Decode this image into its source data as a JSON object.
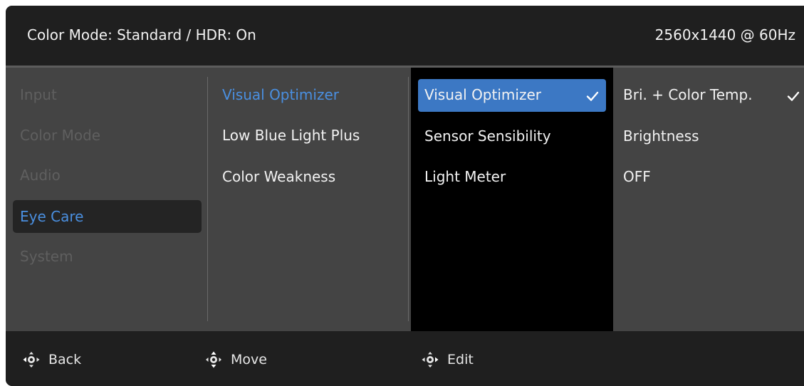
{
  "header": {
    "title": "Color Mode: Standard / HDR: On",
    "resolution": "2560x1440 @ 60Hz"
  },
  "main_menu": {
    "items": [
      {
        "label": "Input"
      },
      {
        "label": "Color Mode"
      },
      {
        "label": "Audio"
      },
      {
        "label": "Eye Care"
      },
      {
        "label": "System"
      }
    ],
    "selected": "Eye Care"
  },
  "sub_menu": {
    "items": [
      {
        "label": "Visual Optimizer"
      },
      {
        "label": "Low Blue Light Plus"
      },
      {
        "label": "Color Weakness"
      }
    ],
    "selected": "Visual Optimizer"
  },
  "options_menu": {
    "items": [
      {
        "label": "Visual Optimizer"
      },
      {
        "label": "Sensor Sensibility"
      },
      {
        "label": "Light Meter"
      }
    ],
    "highlighted": "Visual Optimizer"
  },
  "values_menu": {
    "items": [
      {
        "label": "Bri. + Color Temp."
      },
      {
        "label": "Brightness"
      },
      {
        "label": "OFF"
      }
    ],
    "checked": "Bri. + Color Temp."
  },
  "footer": {
    "back_label": "Back",
    "move_label": "Move",
    "edit_label": "Edit"
  },
  "colors": {
    "accent": "#4a8fe0",
    "highlight": "#3c78c4",
    "panel": "#444444",
    "header": "#1f1f1f"
  }
}
